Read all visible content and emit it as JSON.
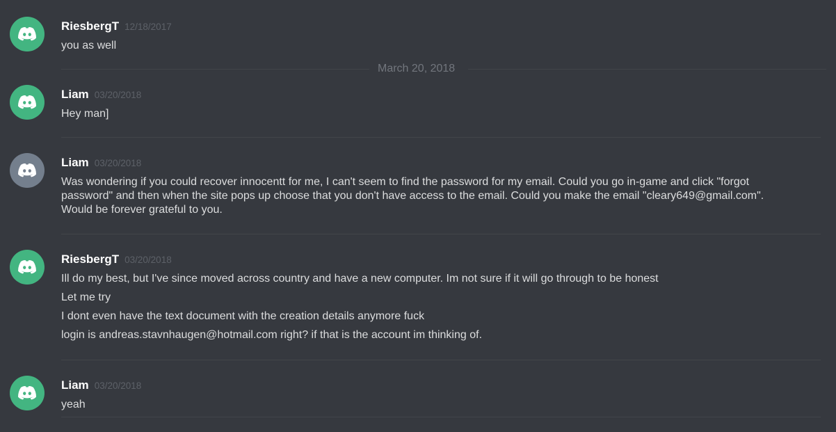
{
  "colors": {
    "background": "#36393f",
    "avatar_green": "#43b581",
    "avatar_gray": "#747f8d",
    "username": "#ffffff",
    "timestamp": "#5d6168",
    "message_text": "#dcddde"
  },
  "date_divider": "March 20, 2018",
  "messages": [
    {
      "avatar_icon": "discord-logo-icon",
      "username": "RiesbergT",
      "timestamp": "12/18/2017",
      "lines": [
        "you as well"
      ]
    },
    {
      "avatar_icon": "discord-logo-icon",
      "username": "Liam",
      "timestamp": "03/20/2018",
      "lines": [
        "Hey man]"
      ]
    },
    {
      "avatar_icon": "discord-logo-icon",
      "username": "Liam",
      "timestamp": "03/20/2018",
      "lines": [
        "Was wondering if you could recover innocentt for me, I can't seem to find the password for my email. Could you go in-game and click \"forgot password\" and then when the site pops up choose that you don't have access to the email. Could you make the email \"cleary649@gmail.com\". Would be forever grateful to you."
      ]
    },
    {
      "avatar_icon": "discord-logo-icon",
      "username": "RiesbergT",
      "timestamp": "03/20/2018",
      "lines": [
        "Ill do my best, but I've since moved across country and have a new computer. Im not sure if it will go through to be honest",
        "Let me try",
        "I dont even have the text document with the creation details anymore fuck",
        "login is andreas.stavnhaugen@hotmail.com right? if that is the account im thinking of."
      ]
    },
    {
      "avatar_icon": "discord-logo-icon",
      "username": "Liam",
      "timestamp": "03/20/2018",
      "lines": [
        "yeah"
      ]
    }
  ]
}
